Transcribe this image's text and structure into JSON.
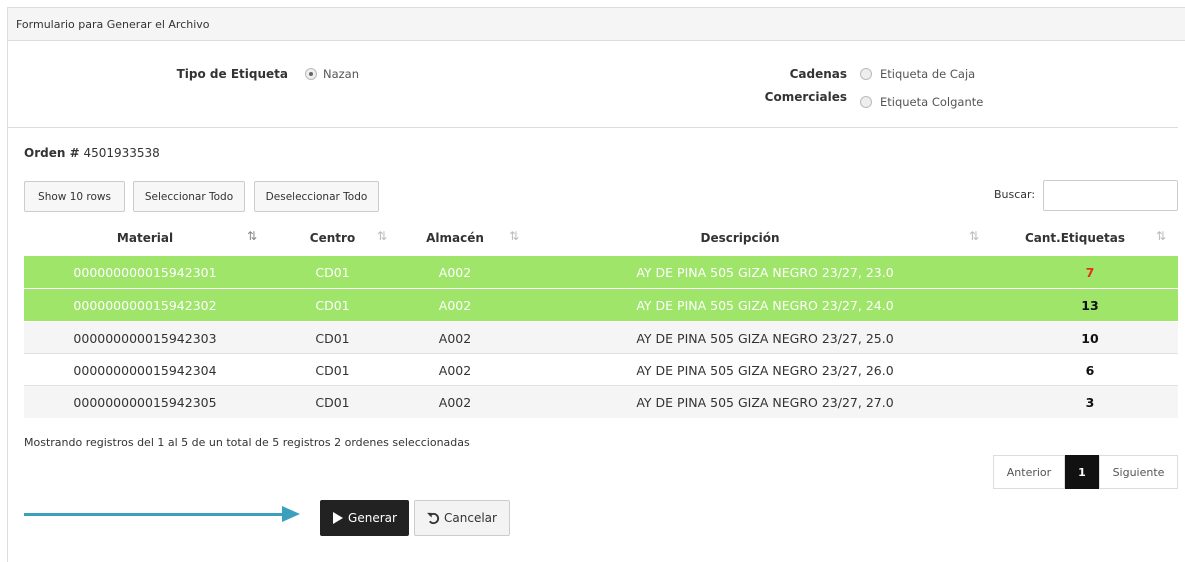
{
  "panel": {
    "title": "Formulario para Generar el Archivo"
  },
  "form": {
    "tipo_label": "Tipo de Etiqueta",
    "tipo_option": "Nazan",
    "cadenas_label_1": "Cadenas",
    "cadenas_label_2": "Comerciales",
    "option_caja": "Etiqueta de Caja",
    "option_colgante": "Etiqueta Colgante"
  },
  "orden": {
    "label": "Orden #",
    "number": "4501933538"
  },
  "toolbar": {
    "show_rows": "Show 10 rows",
    "select_all": "Seleccionar Todo",
    "deselect_all": "Deseleccionar Todo",
    "search_label": "Buscar:",
    "search_value": ""
  },
  "table": {
    "headers": [
      "Material",
      "Centro",
      "Almacén",
      "Descripción",
      "Cant.Etiquetas"
    ],
    "rows": [
      {
        "material": "000000000015942301",
        "centro": "CD01",
        "almacen": "A002",
        "descripcion": "AY DE PINA 505 GIZA NEGRO 23/27, 23.0",
        "cant": "7",
        "selected": true
      },
      {
        "material": "000000000015942302",
        "centro": "CD01",
        "almacen": "A002",
        "descripcion": "AY DE PINA 505 GIZA NEGRO 23/27, 24.0",
        "cant": "13",
        "selected": true
      },
      {
        "material": "000000000015942303",
        "centro": "CD01",
        "almacen": "A002",
        "descripcion": "AY DE PINA 505 GIZA NEGRO 23/27, 25.0",
        "cant": "10",
        "selected": false
      },
      {
        "material": "000000000015942304",
        "centro": "CD01",
        "almacen": "A002",
        "descripcion": "AY DE PINA 505 GIZA NEGRO 23/27, 26.0",
        "cant": "6",
        "selected": false
      },
      {
        "material": "000000000015942305",
        "centro": "CD01",
        "almacen": "A002",
        "descripcion": "AY DE PINA 505 GIZA NEGRO 23/27, 27.0",
        "cant": "3",
        "selected": false
      }
    ]
  },
  "info": "Mostrando registros del 1 al 5 de un total de 5 registros   2 ordenes seleccionadas",
  "pagination": {
    "prev": "Anterior",
    "current": "1",
    "next": "Siguiente"
  },
  "actions": {
    "generate": "Generar",
    "cancel": "Cancelar"
  },
  "colors": {
    "selected_row": "#9ee56a",
    "arrow": "#3ba0be",
    "highlight_qty": "#e4321b"
  },
  "icons": {
    "sort": "sort-icon",
    "play": "play-icon",
    "undo": "undo-icon",
    "arrow": "arrow-right-icon"
  }
}
